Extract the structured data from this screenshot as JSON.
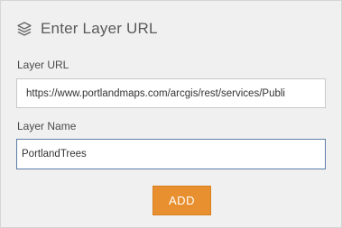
{
  "header": {
    "title": "Enter Layer URL",
    "icon": "layers-icon"
  },
  "form": {
    "url_label": "Layer URL",
    "url_value": "https://www.portlandmaps.com/arcgis/rest/services/Publi",
    "name_label": "Layer Name",
    "name_value": "PortlandTrees",
    "add_label": "ADD"
  },
  "colors": {
    "panel_background": "#f0f0f0",
    "accent_button": "#e8902f",
    "focused_border": "#5a7fa8"
  }
}
